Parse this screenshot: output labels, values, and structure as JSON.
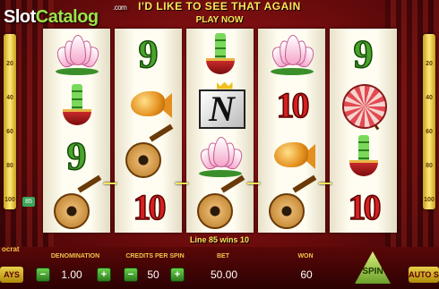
{
  "header": {
    "line1": "I'D LIKE TO SEE THAT AGAIN",
    "line2": "PLAY NOW"
  },
  "logo": {
    "text_a": "Slot",
    "text_b": "Catalog",
    "suffix": ".com"
  },
  "meters": {
    "left": [
      "20",
      "40",
      "60",
      "80",
      "100"
    ],
    "right": [
      "20",
      "40",
      "60",
      "80",
      "100"
    ],
    "marker": "85"
  },
  "reels": [
    [
      "lotus",
      "bamboo",
      "nine",
      "lute"
    ],
    [
      "nine",
      "fish",
      "lute",
      "ten"
    ],
    [
      "bamboo",
      "wild",
      "lotus",
      "lute"
    ],
    [
      "lotus",
      "ten",
      "fish",
      "lute"
    ],
    [
      "nine",
      "umbrella",
      "bamboo",
      "ten"
    ]
  ],
  "symbols": {
    "nine": "9",
    "ten": "10",
    "wild": "N"
  },
  "win_info": {
    "text": "Line 85  wins 10"
  },
  "brand_fragment": "ocrat",
  "controls": {
    "left_button": "AYS",
    "denomination": {
      "label": "DENOMINATION",
      "value": "1.00"
    },
    "credits_per_spin": {
      "label": "CREDITS PER SPIN",
      "value": "50"
    },
    "bet": {
      "label": "BET",
      "value": "50.00"
    },
    "won": {
      "label": "WON",
      "value": "60"
    },
    "spin": "SPIN",
    "autospin": "AUTO S",
    "minus": "−",
    "plus": "+"
  },
  "colors": {
    "accent": "#ffe65a",
    "background": "#6a0b0c",
    "reel": "#fffdf1"
  }
}
